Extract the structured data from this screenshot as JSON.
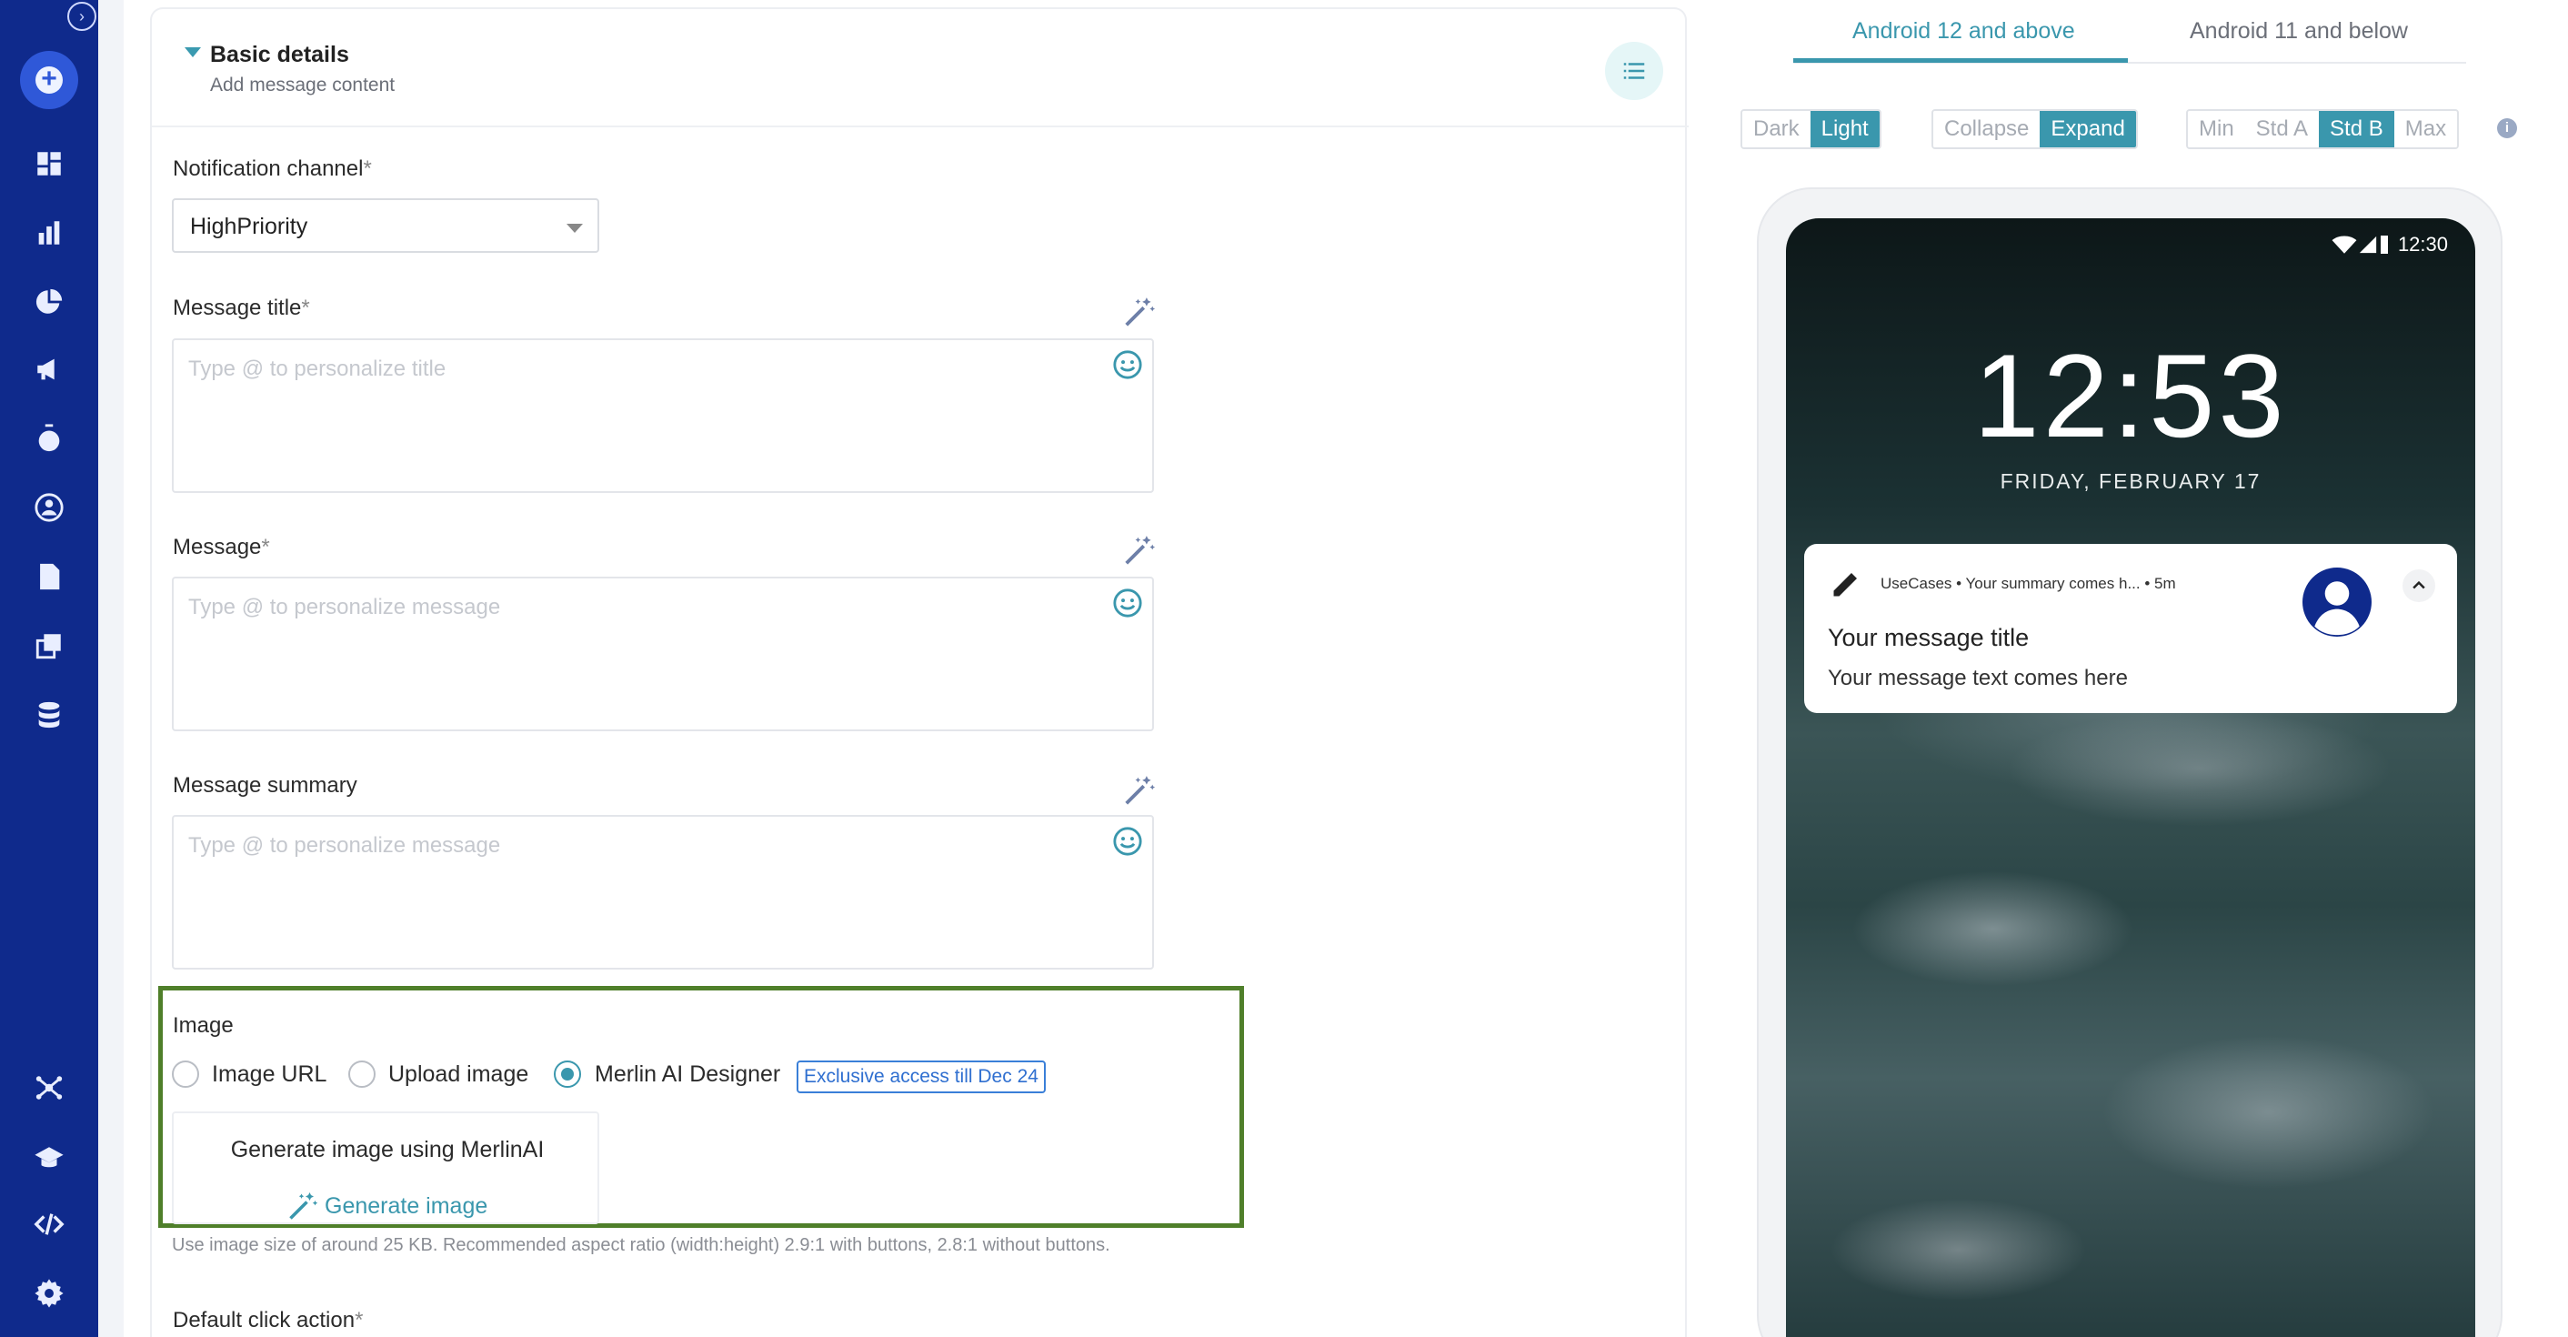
{
  "sidebar": {
    "toggle_icon": "chevron-right-circle-icon",
    "create_icon": "plus-icon",
    "items": [
      {
        "name": "dashboard-icon"
      },
      {
        "name": "analytics-icon"
      },
      {
        "name": "pie-chart-icon"
      },
      {
        "name": "campaign-megaphone-icon"
      },
      {
        "name": "stopwatch-icon"
      },
      {
        "name": "user-segment-icon"
      },
      {
        "name": "document-icon"
      },
      {
        "name": "templates-icon"
      },
      {
        "name": "database-icon"
      }
    ],
    "bottom_items": [
      {
        "name": "integrations-icon"
      },
      {
        "name": "academy-icon"
      },
      {
        "name": "code-icon"
      },
      {
        "name": "settings-icon"
      }
    ]
  },
  "section": {
    "title": "Basic details",
    "subtitle": "Add message content"
  },
  "form": {
    "channel": {
      "label": "Notification channel",
      "required": "*",
      "value": "HighPriority"
    },
    "title": {
      "label": "Message title",
      "required": "*",
      "placeholder": "Type @ to personalize title"
    },
    "message": {
      "label": "Message",
      "required": "*",
      "placeholder": "Type @ to personalize message"
    },
    "summary": {
      "label": "Message summary",
      "placeholder": "Type @ to personalize message"
    },
    "image": {
      "label": "Image",
      "options": [
        "Image URL",
        "Upload image",
        "Merlin AI Designer"
      ],
      "selected": "Merlin AI Designer",
      "badge": "Exclusive access till Dec 24",
      "generate_title": "Generate image using MerlinAI",
      "generate_link": "Generate image",
      "hint": "Use image size of around 25 KB. Recommended aspect ratio (width:height) 2.9:1 with buttons, 2.8:1 without buttons."
    },
    "click_action": {
      "label": "Default click action",
      "required": "*"
    }
  },
  "preview": {
    "tabs": [
      "Android 12 and above",
      "Android 11 and below"
    ],
    "active_tab": "Android 12 and above",
    "theme": {
      "options": [
        "Dark",
        "Light"
      ],
      "selected": "Light"
    },
    "state": {
      "options": [
        "Collapse",
        "Expand"
      ],
      "selected": "Expand"
    },
    "size": {
      "options": [
        "Min",
        "Std A",
        "Std B",
        "Max"
      ],
      "selected": "Std B"
    },
    "status_time": "12:30",
    "clock": "12:53",
    "date": "FRIDAY, FEBRUARY 17",
    "notification": {
      "meta": "UseCases • Your summary comes h...  • 5m",
      "title": "Your message title",
      "text": "Your message text comes here"
    }
  },
  "colors": {
    "sidebar": "#0f2a8c",
    "accent": "#3a97ad",
    "highlight_border": "#4f7f2a"
  }
}
